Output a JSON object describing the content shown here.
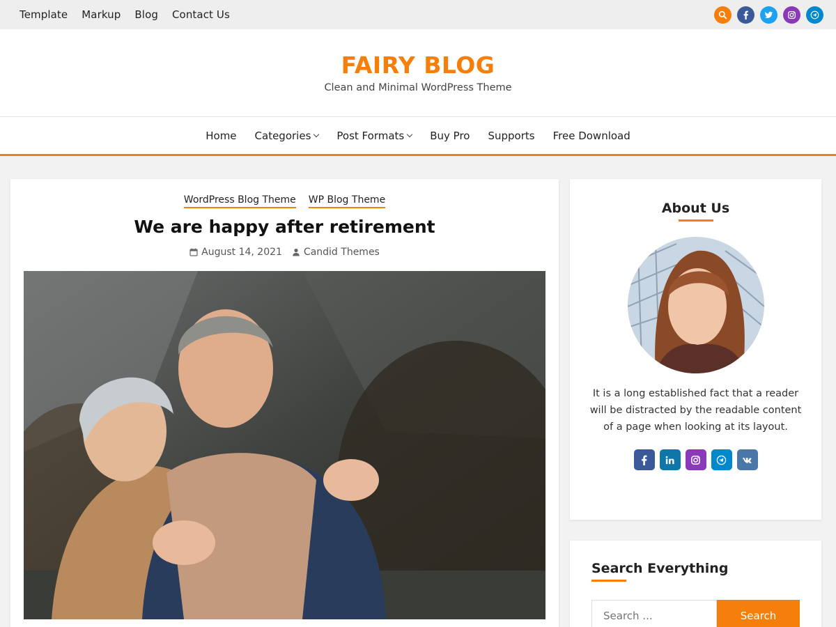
{
  "colors": {
    "accent": "#f57f0a",
    "facebook": "#3b5998",
    "twitter": "#1da1f2",
    "instagram": "#8a3ab9",
    "telegram": "#0088cc",
    "linkedin": "#0e76a8",
    "vk": "#4a76a8"
  },
  "topbar": {
    "links": [
      "Template",
      "Markup",
      "Blog",
      "Contact Us"
    ],
    "icons": [
      "search-icon",
      "facebook-icon",
      "twitter-icon",
      "instagram-icon",
      "telegram-icon"
    ]
  },
  "header": {
    "title": "FAIRY BLOG",
    "tagline": "Clean and Minimal WordPress Theme"
  },
  "nav": {
    "items": [
      {
        "label": "Home"
      },
      {
        "label": "Categories"
      },
      {
        "label": "Post Formats"
      },
      {
        "label": "Buy Pro"
      },
      {
        "label": "Supports"
      },
      {
        "label": "Free Download"
      }
    ]
  },
  "post": {
    "categories": [
      "WordPress Blog Theme",
      "WP Blog Theme"
    ],
    "title": "We are happy after retirement",
    "date": "August 14, 2021",
    "author": "Candid Themes"
  },
  "sidebar": {
    "about": {
      "title": "About Us",
      "text": "It is a long established fact that a reader will be distracted by the readable content of a page when looking at its layout.",
      "socials": [
        "facebook-icon",
        "linkedin-icon",
        "instagram-icon",
        "telegram-icon",
        "vk-icon"
      ]
    },
    "search": {
      "title": "Search Everything",
      "placeholder": "Search ...",
      "button": "Search"
    }
  }
}
